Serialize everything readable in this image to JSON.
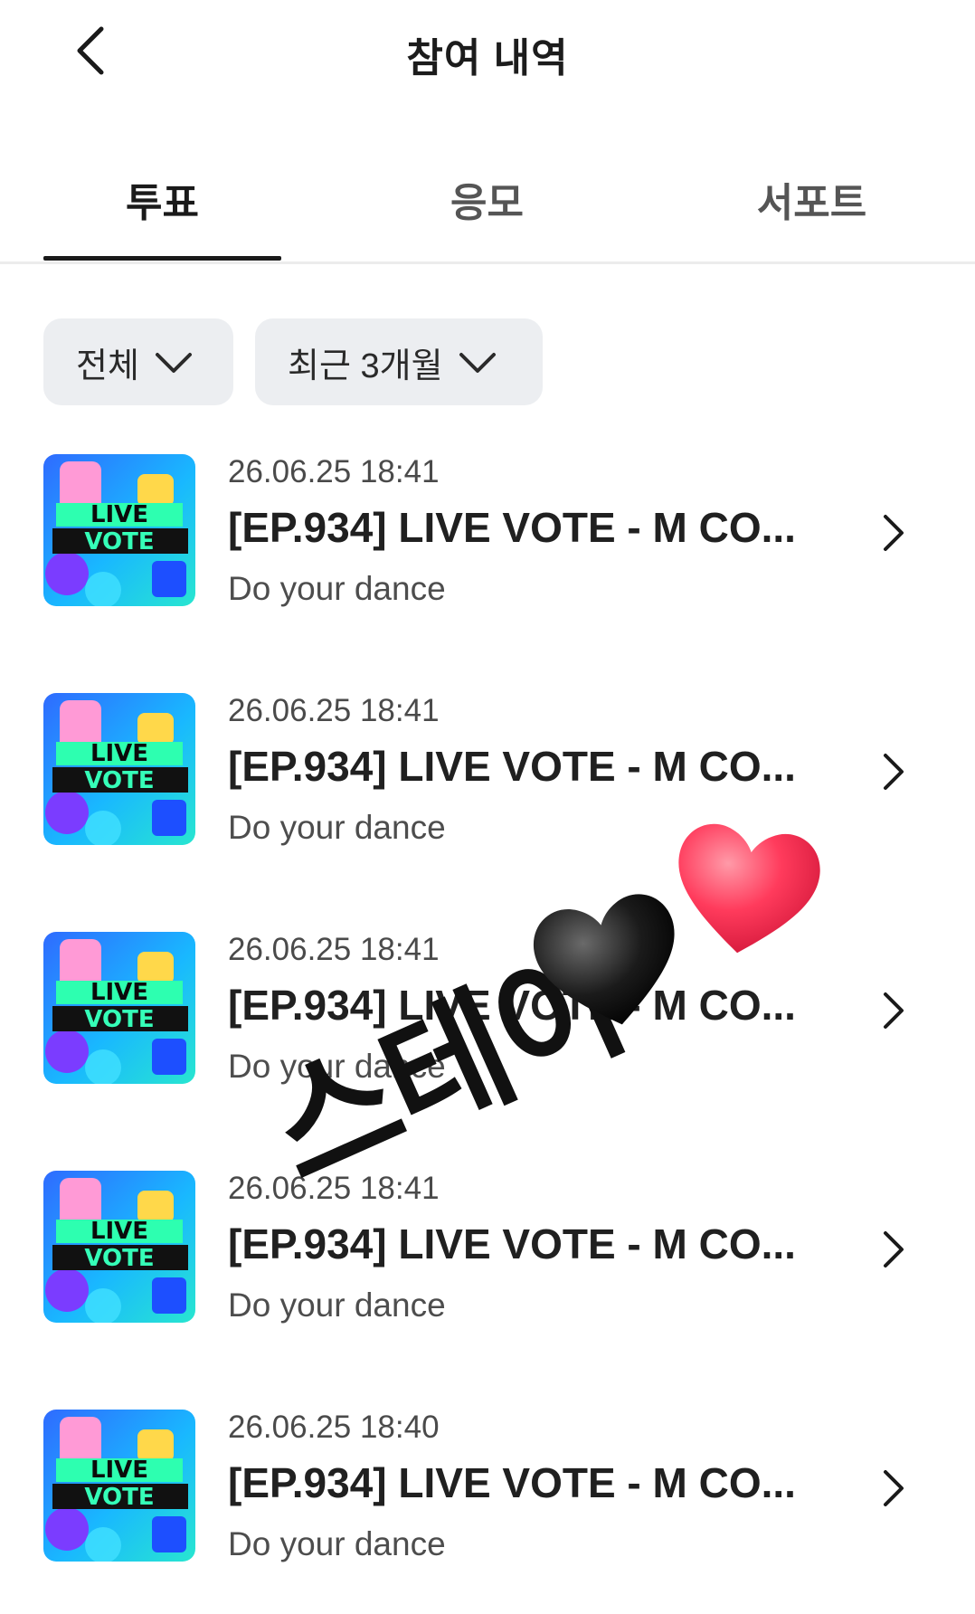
{
  "header": {
    "title": "참여 내역"
  },
  "tabs": [
    {
      "label": "투표",
      "active": true
    },
    {
      "label": "응모",
      "active": false
    },
    {
      "label": "서포트",
      "active": false
    }
  ],
  "filters": {
    "type": "전체",
    "period": "최근 3개월"
  },
  "thumbnail": {
    "line1": "LIVE",
    "line2": "VOTE"
  },
  "items": [
    {
      "date": "26.06.25 18:41",
      "title": "[EP.934] LIVE VOTE - M CO...",
      "subtitle": "Do your dance"
    },
    {
      "date": "26.06.25 18:41",
      "title": "[EP.934] LIVE VOTE - M CO...",
      "subtitle": "Do your dance"
    },
    {
      "date": "26.06.25 18:41",
      "title": "[EP.934] LIVE VOTE - M CO...",
      "subtitle": "Do your dance"
    },
    {
      "date": "26.06.25 18:41",
      "title": "[EP.934] LIVE VOTE - M CO...",
      "subtitle": "Do your dance"
    },
    {
      "date": "26.06.25 18:40",
      "title": "[EP.934] LIVE VOTE - M CO...",
      "subtitle": "Do your dance"
    }
  ],
  "watermark": {
    "text": "스테이"
  },
  "colors": {
    "heart_black": "#1b1b1b",
    "heart_red": "#ff3b5c",
    "chip_bg": "#eceef1"
  }
}
